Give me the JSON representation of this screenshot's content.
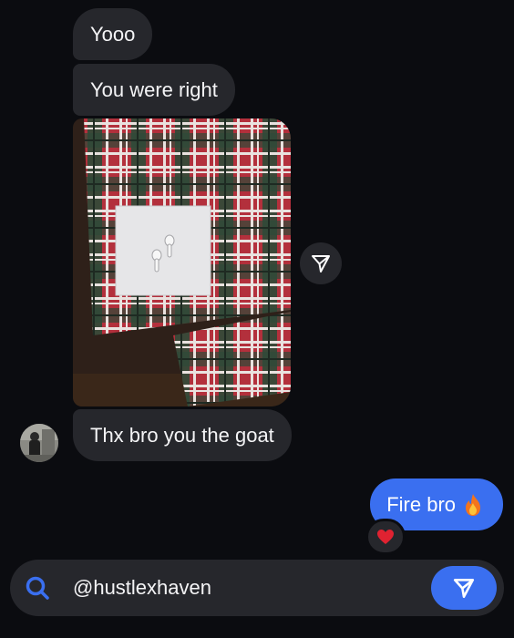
{
  "messages": {
    "m1": "Yooo",
    "m2": "You were right",
    "m3": "Thx bro you the goat",
    "sent": "Fire bro"
  },
  "icons": {
    "sent_emoji": "fire-emoji",
    "reaction": "red-heart-emoji",
    "share": "paper-plane-outline-icon",
    "search": "search-icon",
    "send": "paper-plane-icon"
  },
  "composer": {
    "value": "@hustlexhaven"
  },
  "colors": {
    "background": "#0b0c10",
    "incoming_bubble": "#26272c",
    "outgoing_bubble": "#3a6ff0",
    "accent": "#3a6ff0"
  }
}
